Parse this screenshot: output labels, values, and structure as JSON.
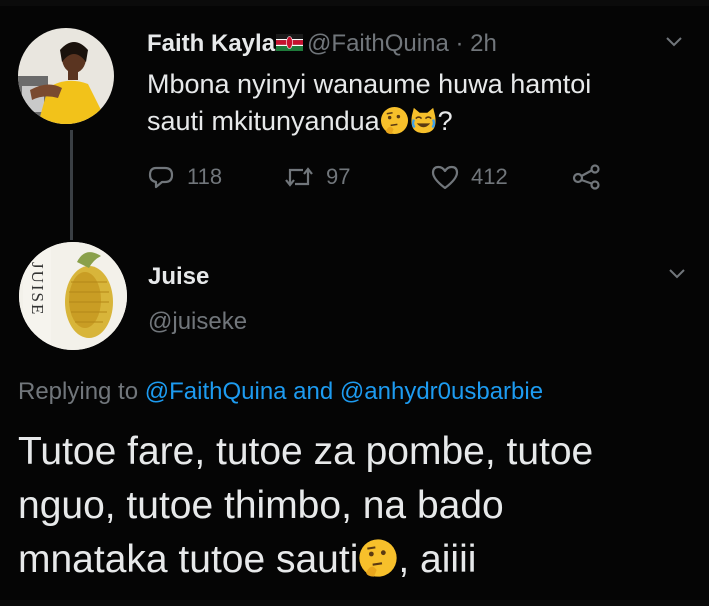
{
  "tweet": {
    "author_name": "Faith Kayla",
    "author_handle": "@FaithQuina",
    "separator": " · ",
    "time": "2h",
    "text_line1": "Mbona  nyinyi wanaume huwa hamtoi",
    "text_line2": "sauti mkitunyandua",
    "text_tail": "?",
    "emojis": [
      "thinking-face-emoji",
      "crying-cat-emoji"
    ],
    "flag": "kenya-flag-icon",
    "replies": "118",
    "retweets": "97",
    "likes": "412"
  },
  "reply": {
    "author_name": "Juise",
    "author_handle": "@juiseke",
    "avatar_text": "JUISE",
    "replying_prefix": "Replying to ",
    "mention1": "@FaithQuina",
    "and_word": " and ",
    "mention2": "@anhydr0usbarbie",
    "text_line1": "Tutoe fare, tutoe za pombe, tutoe",
    "text_line2": "nguo, tutoe thimbo, na bado",
    "text_line3_pre": "mnataka tutoe sauti",
    "text_line3_post": ", aiiii",
    "emoji": "thinking-face-emoji"
  },
  "colors": {
    "background": "#000000",
    "text": "#e7e9ea",
    "muted": "#71767b",
    "link": "#1d9bf0"
  }
}
